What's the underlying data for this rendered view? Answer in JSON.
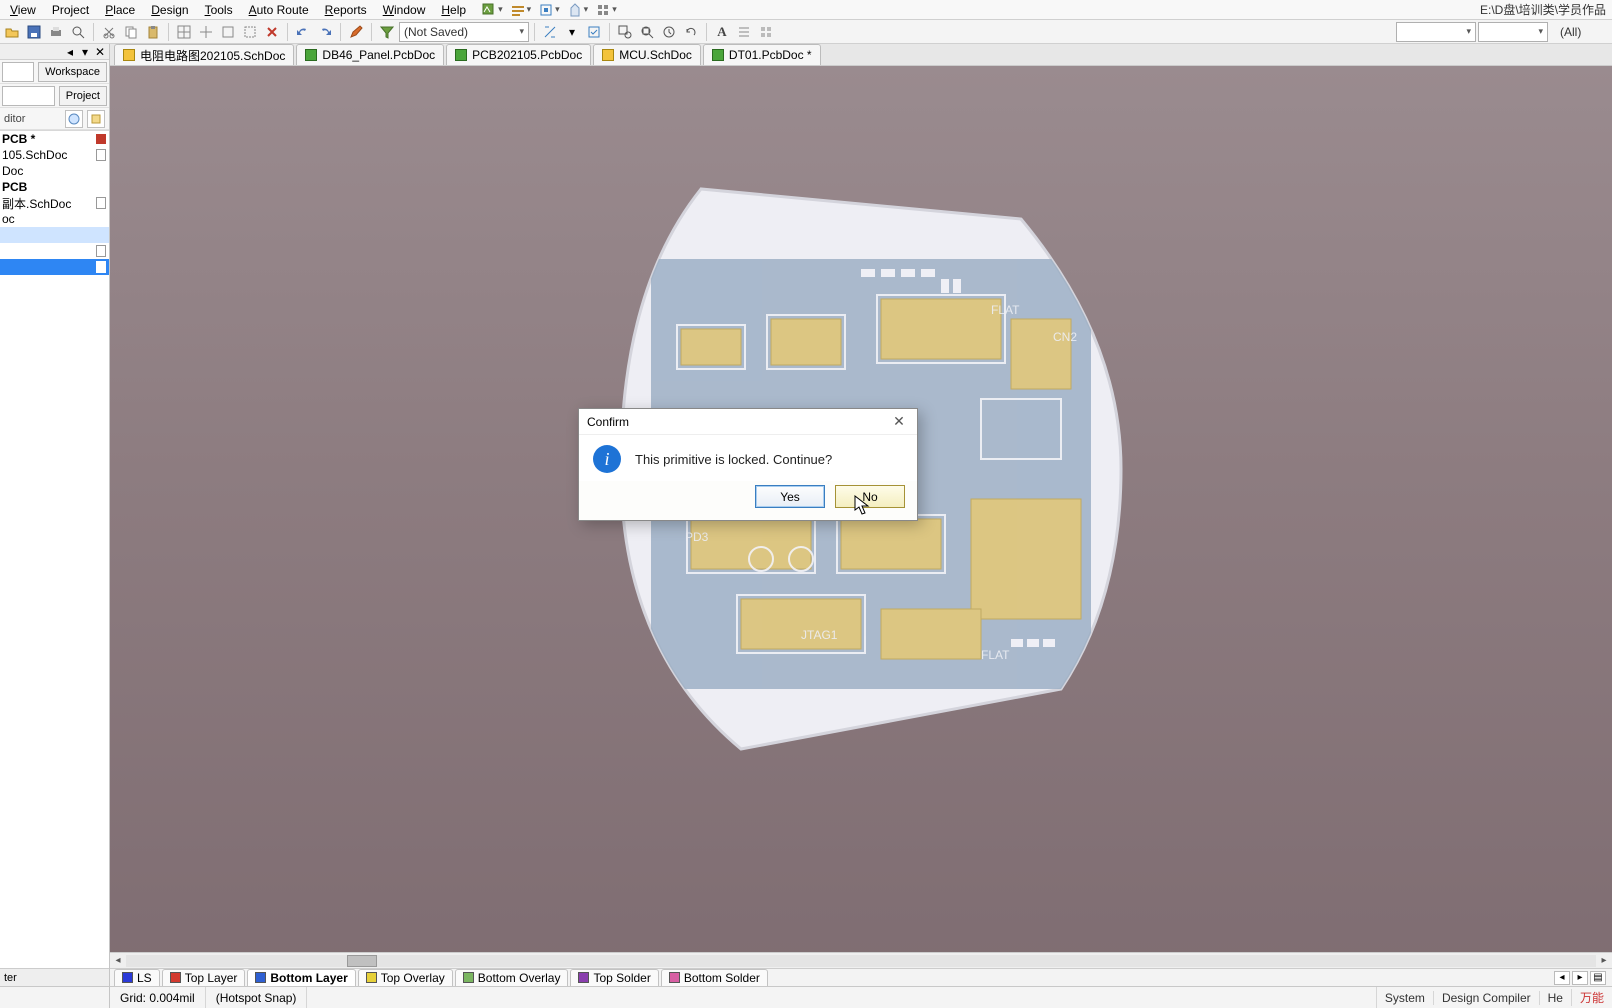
{
  "menu": {
    "items": [
      "View",
      "Project",
      "Place",
      "Design",
      "Tools",
      "Auto Route",
      "Reports",
      "Window",
      "Help"
    ],
    "right_path": "E:\\D盘\\培训类\\学员作品"
  },
  "toolbar": {
    "saved_combo": "(Not Saved)",
    "filter_combo": "",
    "filter_all": "(All)"
  },
  "doc_tabs": [
    {
      "label": "电阻电路图202105.SchDoc",
      "type": "sch"
    },
    {
      "label": "DB46_Panel.PcbDoc",
      "type": "pcb"
    },
    {
      "label": "PCB202105.PcbDoc",
      "type": "pcb"
    },
    {
      "label": "MCU.SchDoc",
      "type": "sch"
    },
    {
      "label": "DT01.PcbDoc *",
      "type": "pcb"
    }
  ],
  "leftpanel": {
    "workspace_btn": "Workspace",
    "project_btn": "Project",
    "editor_label": "ditor",
    "tree": [
      {
        "label": "PCB *",
        "bold": true,
        "icon": "red"
      },
      {
        "label": "105.SchDoc",
        "icon": "doc"
      },
      {
        "label": "Doc",
        "icon": ""
      },
      {
        "label": "PCB",
        "bold": true
      },
      {
        "label": "副本.SchDoc",
        "icon": "doc"
      },
      {
        "label": "oc"
      },
      {
        "label": "",
        "sel2": true
      },
      {
        "label": "",
        "icon": "doc"
      },
      {
        "label": "",
        "sel": true,
        "icon": "docw"
      }
    ],
    "bottom_tab": "ter"
  },
  "dialog": {
    "title": "Confirm",
    "message": "This primitive is locked. Continue?",
    "yes": "Yes",
    "no": "No"
  },
  "layers": {
    "ls": "LS",
    "items": [
      {
        "label": "Top Layer",
        "color": "#d23a2f"
      },
      {
        "label": "Bottom Layer",
        "color": "#2f60d2",
        "active": true
      },
      {
        "label": "Top Overlay",
        "color": "#e7d13a"
      },
      {
        "label": "Bottom Overlay",
        "color": "#7bb661"
      },
      {
        "label": "Top Solder",
        "color": "#8a3fae"
      },
      {
        "label": "Bottom Solder",
        "color": "#d75fa3"
      }
    ]
  },
  "status": {
    "grid": "Grid: 0.004mil",
    "snap": "(Hotspot Snap)",
    "links": [
      "System",
      "Design Compiler",
      "He"
    ],
    "wn": "万能"
  }
}
